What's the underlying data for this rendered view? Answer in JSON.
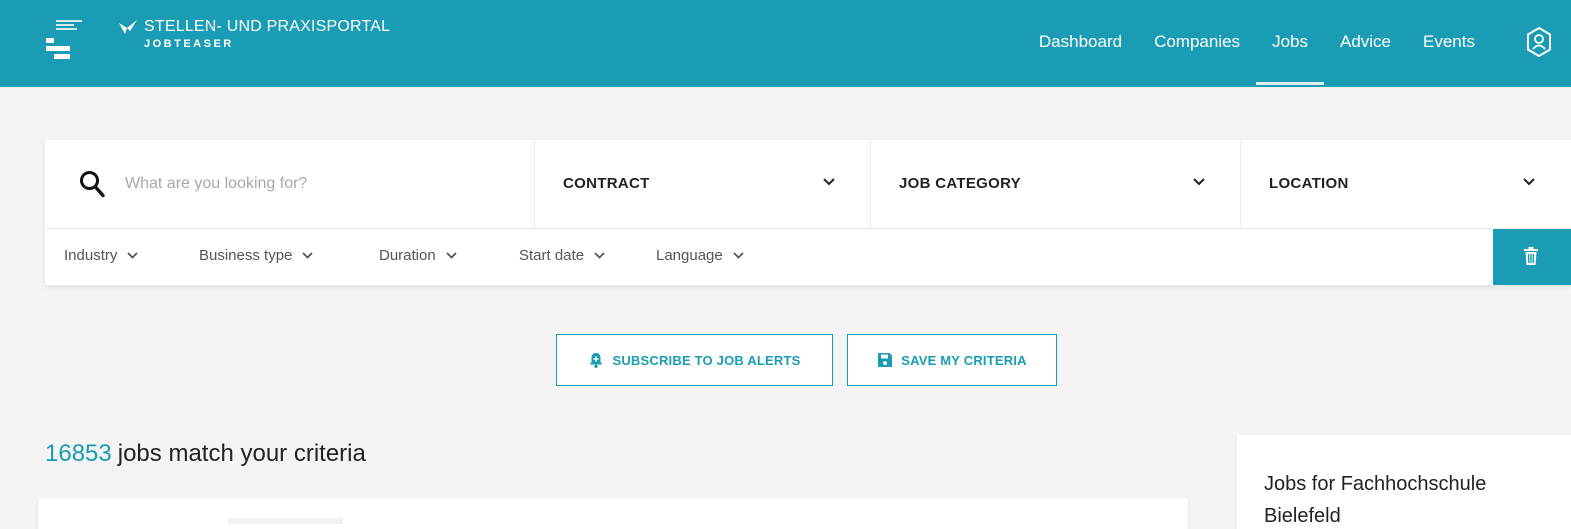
{
  "header": {
    "portal_title": "STELLEN- UND PRAXISPORTAL",
    "portal_subtitle": "JOBTEASER",
    "nav": [
      {
        "label": "Dashboard",
        "active": false
      },
      {
        "label": "Companies",
        "active": false
      },
      {
        "label": "Jobs",
        "active": true
      },
      {
        "label": "Advice",
        "active": false
      },
      {
        "label": "Events",
        "active": false
      }
    ],
    "user_icon": "user-profile-icon"
  },
  "search": {
    "placeholder": "What are you looking for?",
    "value": "",
    "icon": "search-icon",
    "dropdowns": [
      {
        "label": "CONTRACT"
      },
      {
        "label": "JOB CATEGORY"
      },
      {
        "label": "LOCATION"
      }
    ],
    "filters": [
      {
        "label": "Industry"
      },
      {
        "label": "Business type"
      },
      {
        "label": "Duration"
      },
      {
        "label": "Start date"
      },
      {
        "label": "Language"
      }
    ],
    "clear_icon": "trash-icon"
  },
  "actions": {
    "subscribe_label": "SUBSCRIBE TO JOB ALERTS",
    "save_label": "SAVE MY CRITERIA"
  },
  "results": {
    "count": "16853",
    "text": "jobs match your criteria"
  },
  "sidebar": {
    "title": "Jobs for Fachhochschule Bielefeld"
  },
  "colors": {
    "primary": "#1a9cb4",
    "background": "#f4f4f4"
  }
}
